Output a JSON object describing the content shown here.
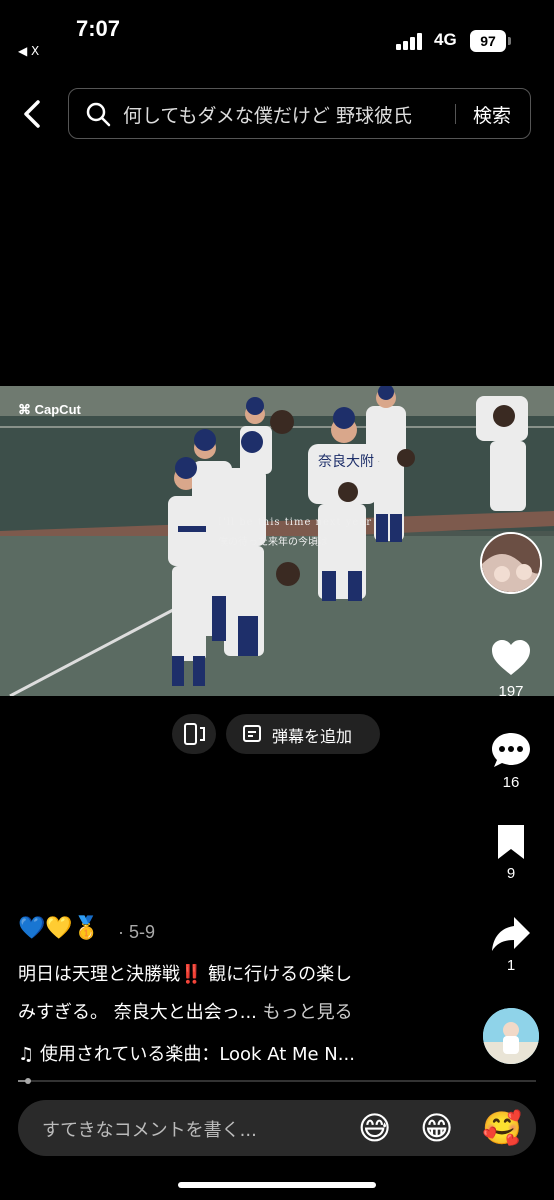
{
  "status_bar": {
    "time": "7:07",
    "back_app": "◀ X",
    "network": "4G",
    "battery": "97"
  },
  "header": {
    "search_query": "何してもダメな僕だけど 野球彼氏",
    "search_button": "検索"
  },
  "video": {
    "watermark": "CapCut",
    "overlay_line1": "I'll be this time next year",
    "overlay_line2": "僕の待った来年の今頃は",
    "danmaku_label": "弾幕を追加"
  },
  "actions": {
    "likes": "197",
    "comments": "16",
    "saves": "9",
    "shares": "1"
  },
  "post": {
    "emojis": "💙💛🥇",
    "date": "· 5-9",
    "caption_line1": "明日は天理と決勝戦‼️ 観に行けるの楽し",
    "caption_line2": "みすぎる。 奈良大と出会っ...",
    "more_label": "もっと見る",
    "music": "♫ 使用されている楽曲：Look At Me N...",
    "progress": 0.02
  },
  "comment_bar": {
    "placeholder": "すてきなコメントを書く...",
    "emoji_1": "😅",
    "emoji_2": "😁",
    "emoji_3": "🥰"
  },
  "colors": {
    "background": "#000000",
    "field": "#4a5650",
    "dirt": "#8a6a5a",
    "uniform": "#e8e8e8",
    "accent_blue": "#1e2f6a"
  }
}
